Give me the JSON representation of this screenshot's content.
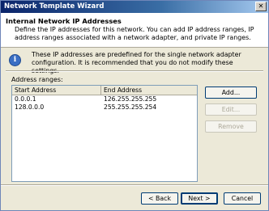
{
  "window": {
    "title": "Network Template Wizard",
    "close_glyph": "✕"
  },
  "header": {
    "title": "Internal Network IP Addresses",
    "description": "Define the IP addresses for this network. You can add IP address ranges, IP address ranges associated with a network adapter, and private IP ranges."
  },
  "info": {
    "icon": "info-icon",
    "glyph": "i",
    "text": "These IP addresses are predefined for the single network adapter configuration. It is recommended that you do not modify these settings."
  },
  "ranges": {
    "label": "Address ranges:",
    "columns": [
      "Start Address",
      "End Address"
    ],
    "rows": [
      {
        "start": "0.0.0.1",
        "end": "126.255.255.255"
      },
      {
        "start": "128.0.0.0",
        "end": "255.255.255.254"
      }
    ]
  },
  "side_buttons": {
    "add": "Add...",
    "edit": "Edit...",
    "remove": "Remove"
  },
  "footer": {
    "back": "< Back",
    "next": "Next >",
    "cancel": "Cancel"
  }
}
